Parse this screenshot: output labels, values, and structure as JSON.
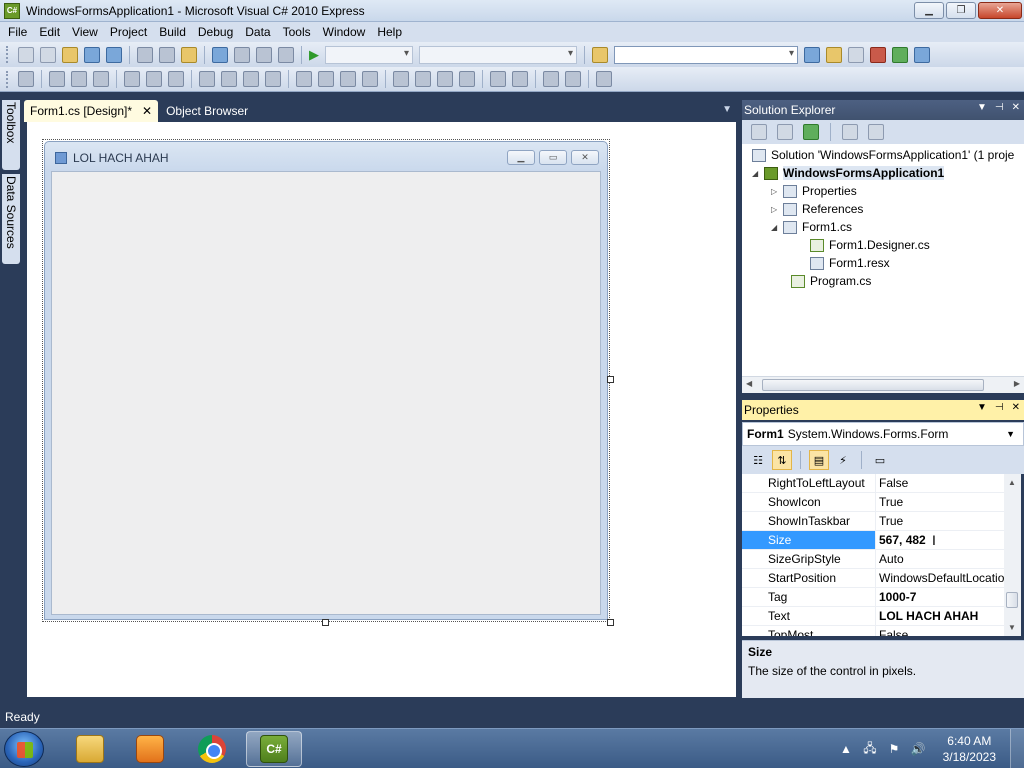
{
  "window": {
    "title": "WindowsFormsApplication1 - Microsoft Visual C# 2010 Express",
    "app_icon_text": "C#"
  },
  "menu": [
    "File",
    "Edit",
    "View",
    "Project",
    "Build",
    "Debug",
    "Data",
    "Tools",
    "Window",
    "Help"
  ],
  "side_tabs": {
    "toolbox": "Toolbox",
    "data_sources": "Data Sources"
  },
  "doc_tabs": [
    {
      "label": "Form1.cs [Design]*",
      "active": true
    },
    {
      "label": "Object Browser",
      "active": false
    }
  ],
  "designer": {
    "form_title": "LOL HACH AHAH"
  },
  "solution_explorer": {
    "title": "Solution Explorer",
    "items": [
      {
        "label": "Solution 'WindowsFormsApplication1' (1 proje"
      },
      {
        "label": "WindowsFormsApplication1"
      },
      {
        "label": "Properties"
      },
      {
        "label": "References"
      },
      {
        "label": "Form1.cs"
      },
      {
        "label": "Form1.Designer.cs"
      },
      {
        "label": "Form1.resx"
      },
      {
        "label": "Program.cs"
      }
    ]
  },
  "properties": {
    "title": "Properties",
    "object_name": "Form1",
    "object_type": "System.Windows.Forms.Form",
    "rows": [
      {
        "name": "RightToLeftLayout",
        "value": "False"
      },
      {
        "name": "ShowIcon",
        "value": "True"
      },
      {
        "name": "ShowInTaskbar",
        "value": "True"
      },
      {
        "name": "Size",
        "value": "567, 482"
      },
      {
        "name": "SizeGripStyle",
        "value": "Auto"
      },
      {
        "name": "StartPosition",
        "value": "WindowsDefaultLocatio"
      },
      {
        "name": "Tag",
        "value": "1000-7"
      },
      {
        "name": "Text",
        "value": "LOL HACH AHAH"
      },
      {
        "name": "TopMost",
        "value": "False"
      }
    ],
    "description_title": "Size",
    "description_text": "The size of the control in pixels."
  },
  "status": {
    "text": "Ready"
  },
  "taskbar": {
    "time": "6:40 AM",
    "date": "3/18/2023",
    "active_app_label": "C#"
  },
  "colors": {
    "ide_background": "#2b3c59",
    "selection": "#3399ff",
    "active_tab": "#fffbe0"
  }
}
